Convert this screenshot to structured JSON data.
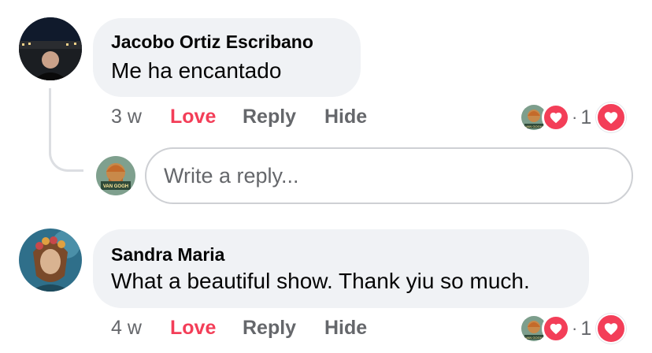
{
  "comments": [
    {
      "author": "Jacobo Ortiz Escribano",
      "text": "Me ha encantado",
      "time": "3 w",
      "love_label": "Love",
      "reply_label": "Reply",
      "hide_label": "Hide",
      "reaction_separator": "·",
      "reaction_count": "1"
    },
    {
      "author": "Sandra Maria",
      "text": "What a beautiful show. Thank yiu so much.",
      "time": "4 w",
      "love_label": "Love",
      "reply_label": "Reply",
      "hide_label": "Hide",
      "reaction_separator": "·",
      "reaction_count": "1"
    }
  ],
  "reply_box": {
    "placeholder": "Write a reply...",
    "avatar_text": "VAN GOGH"
  },
  "reaction_avatar_text": "VAN GOGH",
  "icons": {
    "reaction": "heart-icon",
    "page_avatar": "van-gogh-portrait-avatar"
  },
  "colors": {
    "love": "#f33e58",
    "bubble": "#f0f2f5",
    "muted": "#65676b"
  }
}
